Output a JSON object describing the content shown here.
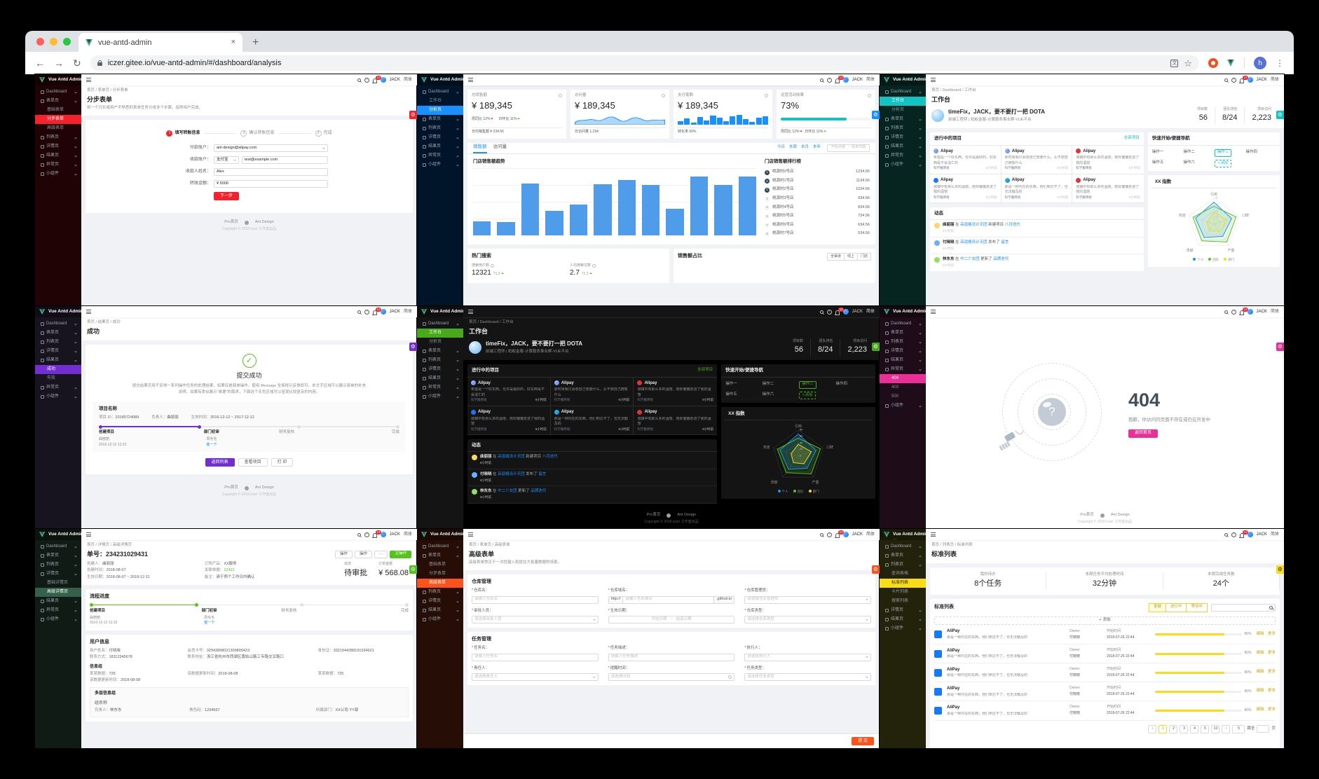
{
  "browser": {
    "tab_title": "vue-antd-admin",
    "close_tab": "×",
    "new_tab": "+",
    "url": "iczer.gitee.io/vue-antd-admin/#/dashboard/analysis",
    "avatar_letter": "h"
  },
  "glyphs": {
    "back": "←",
    "forward": "→",
    "reload": "↻",
    "star": "☆",
    "overflow": "⋮",
    "gear": "⚙",
    "check": "✓",
    "question": "?",
    "translate": "文",
    "alipay": "支",
    "plus": "+"
  },
  "common": {
    "logo": "Vue Antd Admin",
    "user": "JACK",
    "badge": "12",
    "lang": "简体",
    "footer_home": "Pro首页",
    "footer_antd": "Ant Design",
    "copyright": "Copyright © 2018 iczer 工作室出品"
  },
  "menus": {
    "stepform": [
      {
        "t": "Dashboard",
        "cls": "r"
      },
      {
        "t": "表单页",
        "cls": "r"
      },
      {
        "t": "基础表单",
        "cls": "c"
      },
      {
        "t": "分步表单",
        "cls": "c sel"
      },
      {
        "t": "高级表单",
        "cls": "c"
      },
      {
        "t": "列表页",
        "cls": "r"
      },
      {
        "t": "详情页",
        "cls": "r"
      },
      {
        "t": "结果页",
        "cls": "r"
      },
      {
        "t": "异常页",
        "cls": "r"
      },
      {
        "t": "小组件",
        "cls": "r"
      }
    ],
    "analysis": [
      {
        "t": "Dashboard",
        "cls": "r"
      },
      {
        "t": "工作台",
        "cls": "c"
      },
      {
        "t": "分析页",
        "cls": "c sel"
      },
      {
        "t": "表单页",
        "cls": "r"
      },
      {
        "t": "列表页",
        "c ls": "r",
        "cls": "r"
      },
      {
        "t": "详情页",
        "cls": "r"
      },
      {
        "t": "结果页",
        "cls": "r"
      },
      {
        "t": "异常页",
        "cls": "r"
      },
      {
        "t": "小组件",
        "cls": "r"
      }
    ],
    "workplace": [
      {
        "t": "Dashboard",
        "cls": "r"
      },
      {
        "t": "工作台",
        "cls": "c sel"
      },
      {
        "t": "分析页",
        "cls": "c"
      },
      {
        "t": "表单页",
        "cls": "r"
      },
      {
        "t": "列表页",
        "cls": "r"
      },
      {
        "t": "详情页",
        "cls": "r"
      },
      {
        "t": "结果页",
        "cls": "r"
      },
      {
        "t": "异常页",
        "cls": "r"
      },
      {
        "t": "小组件",
        "cls": "r"
      }
    ],
    "success": [
      {
        "t": "Dashboard",
        "cls": "r"
      },
      {
        "t": "表单页",
        "cls": "r"
      },
      {
        "t": "列表页",
        "cls": "r"
      },
      {
        "t": "详情页",
        "cls": "r"
      },
      {
        "t": "结果页",
        "cls": "r"
      },
      {
        "t": "成功",
        "cls": "c sel"
      },
      {
        "t": "失败",
        "cls": "c"
      },
      {
        "t": "异常页",
        "cls": "r"
      },
      {
        "t": "小组件",
        "cls": "r"
      }
    ],
    "notfound": [
      {
        "t": "Dashboard",
        "cls": "r"
      },
      {
        "t": "表单页",
        "cls": "r"
      },
      {
        "t": "列表页",
        "cls": "r"
      },
      {
        "t": "详情页",
        "cls": "r"
      },
      {
        "t": "结果页",
        "cls": "r"
      },
      {
        "t": "异常页",
        "cls": "r"
      },
      {
        "t": "404",
        "cls": "c sel"
      },
      {
        "t": "403",
        "cls": "c"
      },
      {
        "t": "500",
        "cls": "c"
      },
      {
        "t": "小组件",
        "cls": "r"
      }
    ],
    "detail": [
      {
        "t": "Dashboard",
        "cls": "r"
      },
      {
        "t": "表单页",
        "cls": "r"
      },
      {
        "t": "列表页",
        "cls": "r"
      },
      {
        "t": "详情页",
        "cls": "r"
      },
      {
        "t": "基础详情页",
        "cls": "c"
      },
      {
        "t": "高级详情页",
        "cls": "c sel"
      },
      {
        "t": "结果页",
        "cls": "r"
      },
      {
        "t": "异常页",
        "cls": "r"
      },
      {
        "t": "小组件",
        "cls": "r"
      }
    ],
    "advform": [
      {
        "t": "Dashboard",
        "cls": "r"
      },
      {
        "t": "表单页",
        "cls": "r"
      },
      {
        "t": "基础表单",
        "cls": "c"
      },
      {
        "t": "分步表单",
        "cls": "c"
      },
      {
        "t": "高级表单",
        "cls": "c sel"
      },
      {
        "t": "列表页",
        "cls": "r"
      },
      {
        "t": "详情页",
        "cls": "r"
      },
      {
        "t": "结果页",
        "cls": "r"
      },
      {
        "t": "小组件",
        "cls": "r"
      }
    ],
    "stdlist": [
      {
        "t": "Dashboard",
        "cls": "r"
      },
      {
        "t": "表单页",
        "cls": "r"
      },
      {
        "t": "列表页",
        "cls": "r"
      },
      {
        "t": "查询表格",
        "cls": "c"
      },
      {
        "t": "标准列表",
        "cls": "c sel"
      },
      {
        "t": "卡片列表",
        "cls": "c"
      },
      {
        "t": "搜索列表",
        "cls": "c"
      },
      {
        "t": "详情页",
        "cls": "r"
      },
      {
        "t": "结果页",
        "cls": "r"
      },
      {
        "t": "小组件",
        "cls": "r"
      }
    ]
  },
  "stepform": {
    "crumb": "首页 / 表单页 / 分步表单",
    "title": "分步表单",
    "desc": "将一个冗长或用户不熟悉的表单任务分成多个步骤，指导用户完成。",
    "steps": [
      {
        "n": "1",
        "t": "填写转账信息",
        "cls": "cur"
      },
      {
        "n": "2",
        "t": "确认转账信息",
        "cls": ""
      },
      {
        "n": "3",
        "t": "完成",
        "cls": ""
      }
    ],
    "f1_label": "付款账户：",
    "f1_value": "ant-design@alipay.com",
    "f2_label": "收款账户：",
    "f2_select": "支付宝",
    "f2_value": "test@example.com",
    "f3_label": "收款人姓名：",
    "f3_value": "Alex",
    "f4_label": "转账金额：",
    "f4_value": "¥ 5000",
    "next": "下一步"
  },
  "analysis": {
    "card1": {
      "label": "总销售额",
      "value": "¥ 189,345",
      "t1": "周同比 12%",
      "t2": "日环比 11%",
      "foot": "日均销售额 ¥ 234.56"
    },
    "card2": {
      "label": "访问量",
      "value": "¥ 189,345",
      "foot": "日访问量 1,234"
    },
    "card3": {
      "label": "支付笔数",
      "value": "¥ 189,345",
      "foot": "转化率 60%"
    },
    "card4": {
      "label": "运营活动效果",
      "value": "73%",
      "t1": "周同比 12%",
      "t2": "日环比 11%"
    },
    "tabs": [
      "销售额",
      "访问量"
    ],
    "ranges": [
      {
        "t": "今日"
      },
      {
        "t": "本周"
      },
      {
        "t": "本月"
      },
      {
        "t": "本年"
      }
    ],
    "date_start": "开始日期",
    "date_sep": "~",
    "date_end": "结束日期",
    "chart_title": "门店销售额趋势",
    "bars": [
      {
        "v": 21
      },
      {
        "v": 20
      },
      {
        "v": 77
      },
      {
        "v": 36
      },
      {
        "v": 46
      },
      {
        "v": 76
      },
      {
        "v": 82
      },
      {
        "v": 75
      },
      {
        "v": 40
      },
      {
        "v": 88
      },
      {
        "v": 75
      },
      {
        "v": 87
      }
    ],
    "minibars": [
      {
        "v": 5
      },
      {
        "v": 9
      },
      {
        "v": 3
      },
      {
        "v": 11
      },
      {
        "v": 6
      },
      {
        "v": 13
      },
      {
        "v": 10
      },
      {
        "v": 5
      },
      {
        "v": 12
      },
      {
        "v": 14
      },
      {
        "v": 8
      },
      {
        "v": 4
      },
      {
        "v": 10
      },
      {
        "v": 12
      }
    ],
    "progress_pct": 73,
    "rank_title": "门店销售额排行榜",
    "ranks": [
      {
        "r": "1",
        "n": "桃源村0号店",
        "v": "1234.56",
        "cls": "top"
      },
      {
        "r": "2",
        "n": "桃源村1号店",
        "v": "1134.56",
        "cls": "top"
      },
      {
        "r": "3",
        "n": "桃源村2号店",
        "v": "1034.56",
        "cls": "top"
      },
      {
        "r": "4",
        "n": "桃源村3号店",
        "v": "934.56",
        "cls": ""
      },
      {
        "r": "5",
        "n": "桃源村4号店",
        "v": "834.56",
        "cls": ""
      },
      {
        "r": "6",
        "n": "桃源村5号店",
        "v": "734.56",
        "cls": ""
      },
      {
        "r": "7",
        "n": "桃源村6号店",
        "v": "634.56",
        "cls": ""
      },
      {
        "r": "8",
        "n": "桃源村7号店",
        "v": "534.56",
        "cls": ""
      }
    ],
    "hot_title": "热门搜索",
    "hot1_label": "搜索用户数",
    "hot1_value": "12321",
    "hot1_trend": "71.2",
    "hot2_label": "人均搜索次数",
    "hot2_value": "2.7",
    "hot2_trend": "71.2",
    "share_title": "销售额占比",
    "share_tabs": [
      {
        "t": "全渠道"
      },
      {
        "t": "线上"
      },
      {
        "t": "门店"
      }
    ]
  },
  "workplace": {
    "crumb": "首页 / Dashboard / 工作台",
    "title": "工作台",
    "greeting": "timeFix，JACK，要不要打一把 DOTA",
    "sub": "前端工程师 | 蚂蚁金服-计算服务事业群-VUE平台",
    "stats": [
      {
        "label": "项目数",
        "value": "56"
      },
      {
        "label": "团队排名",
        "value": "8/24"
      },
      {
        "label": "项目访问",
        "value": "2,223"
      }
    ],
    "projects_title": "进行中的项目",
    "all_projects": "全部项目",
    "cards": [
      {
        "title": "Alipay",
        "desc": "希望是一个好东西，也许是最好的，好东西是不会消亡的",
        "group": "科学搬砖组",
        "time": "9小时前",
        "cls": "lg-antd"
      },
      {
        "title": "Alipay",
        "desc": "那时候我只会想自己想要什么，从不想自己拥有什么",
        "group": "科学搬砖组",
        "time": "9小时前",
        "cls": "lg-antd"
      },
      {
        "title": "Alipay",
        "desc": "城镇中有那么多的酒馆，她却偏偏走进了我的酒馆",
        "group": "科学搬砖组",
        "time": "9小时前",
        "cls": "lg-ng"
      },
      {
        "title": "Alipay",
        "desc": "城镇中有那么多的酒馆，她却偏偏走进了我的酒馆",
        "group": "科学搬砖组",
        "time": "9小时前",
        "cls": "lg-ali"
      },
      {
        "title": "Alipay",
        "desc": "那是一种内在的东西，他们到达不了，也无法触及的",
        "group": "科学搬砖组",
        "time": "9小时前",
        "cls": "lg-ali2"
      },
      {
        "title": "Alipay",
        "desc": "城镇中有那么多的酒馆，她却偏偏走进了我的酒馆",
        "group": "科学搬砖组",
        "time": "9小时前",
        "cls": "lg-ng"
      }
    ],
    "quick_title": "快速开始/便捷导航",
    "ops": [
      {
        "t": "操作一",
        "cls": ""
      },
      {
        "t": "操作二",
        "cls": ""
      },
      {
        "t": "操作三",
        "cls": "hot"
      },
      {
        "t": "操作四",
        "cls": ""
      },
      {
        "t": "操作五",
        "cls": ""
      },
      {
        "t": "操作六",
        "cls": ""
      }
    ],
    "add": "添加",
    "radar_title": "XX 指数",
    "radar_axes": [
      "引用",
      "口碑",
      "产量",
      "贡献",
      "热度"
    ],
    "radar_ticks": [
      "0",
      "20",
      "40",
      "60",
      "80"
    ],
    "legend": [
      {
        "t": "个人",
        "cls": "dot-blue"
      },
      {
        "t": "团队",
        "cls": "dot-green"
      },
      {
        "t": "部门",
        "cls": "dot-yellow"
      }
    ],
    "feed_title": "动态",
    "feed": [
      {
        "name": "曲丽丽",
        "pre": "在",
        "group": "高逼格设计天团",
        "mid": "新建项目",
        "target": "八月迭代",
        "time": "9小时前",
        "cls": "av-a"
      },
      {
        "name": "付晓晓",
        "pre": "在",
        "group": "高逼格设计天团",
        "mid": "发布了",
        "target": "留言",
        "time": "9小时前",
        "cls": "av-b"
      },
      {
        "name": "林东东",
        "pre": "在",
        "group": "中二少女团",
        "mid": "更新了",
        "target": "品牌迭代",
        "time": "9小时前",
        "cls": "av-c"
      }
    ]
  },
  "success": {
    "crumb": "首页 / 结果页 / 成功",
    "ptitle": "成功",
    "title": "提交成功",
    "desc": "提交结果页用于反馈一系列操作任务的处理结果，如果仅是简单操作，使用 Message 全局提示反馈即可。本文字区域可以展示简单的补充说明，如果有类似展示“单据”的需求，下面这个灰色区域可以呈现比较复杂的内容。",
    "box_title": "项目名称",
    "meta": [
      {
        "l": "项目 ID：",
        "v": "20180724089"
      },
      {
        "l": "负责人：",
        "v": "曲丽丽"
      },
      {
        "l": "生效时间：",
        "v": "2016-12-12 ~ 2017-12-12"
      }
    ],
    "steps": [
      {
        "t": "创建项目",
        "s1": "曲丽丽",
        "s2": "2016-12-12 12:32"
      },
      {
        "t": "部门初审",
        "s1": "周毛毛",
        "link": "催一下"
      },
      {
        "t": "财务复核"
      },
      {
        "t": "完成"
      }
    ],
    "btn1": "返回列表",
    "btn2": "查看项目",
    "btn3": "打 印"
  },
  "notfound": {
    "code": "404",
    "desc": "抱歉，你访问的页面不存在或仍在开发中",
    "btn": "返回首页"
  },
  "detail": {
    "crumb": "首页 / 详情页 / 高级详情页",
    "title": "单号：234231029431",
    "op1": "操作",
    "op2": "操作",
    "op3": "···",
    "op_main": "主操作",
    "info": [
      {
        "l": "创建人：",
        "v": "曲丽丽",
        "cls": ""
      },
      {
        "l": "订购产品：",
        "v": "XX服务",
        "cls": ""
      },
      {
        "l": "创建时间：",
        "v": "2018-08-07",
        "cls": ""
      },
      {
        "l": "关联单据：",
        "v": "12421",
        "cls": "link"
      },
      {
        "l": "生效日期：",
        "v": "2018-08-07 ~ 2018-12-11",
        "cls": ""
      },
      {
        "l": "备注：",
        "v": "请于两个工作日内确认",
        "cls": ""
      }
    ],
    "status_label": "状态",
    "status": "待审批",
    "amount_label": "订单金额",
    "amount": "¥ 568.08",
    "flow_title": "流程进度",
    "steps": [
      {
        "t": "创建项目",
        "s1": "曲丽丽",
        "s2": "2016-12-12 12:32"
      },
      {
        "t": "部门初审",
        "s1": "周毛毛",
        "link": "催一下"
      },
      {
        "t": "财务复核"
      },
      {
        "t": "完成"
      }
    ],
    "user_title": "用户信息",
    "user": [
      {
        "l": "用户姓名：",
        "v": "付晓晓"
      },
      {
        "l": "会员卡号：",
        "v": "32943898021309809423"
      },
      {
        "l": "身份证：",
        "v": "3321944288191034921"
      },
      {
        "l": "联系方式：",
        "v": "18112345678"
      },
      {
        "l": "联系地址：",
        "v": "浙江省杭州市西湖区黄姑山路工专路交叉路口"
      }
    ],
    "group_title": "信息组",
    "group": [
      {
        "l": "某某数据：",
        "v": "725"
      },
      {
        "l": "该数据更新时间：",
        "v": "2018-08-08"
      },
      {
        "l": "某某数据：",
        "v": "725"
      },
      {
        "l": "该数据更新时间：",
        "v": "2018-08-08"
      }
    ],
    "multi_title": "多层信息组",
    "multi_sub": "组名称",
    "multi": [
      {
        "l": "负责人：",
        "v": "林东东"
      },
      {
        "l": "角色码：",
        "v": "1234567"
      },
      {
        "l": "所属部门：",
        "v": "XX公司-YY部"
      }
    ]
  },
  "advform": {
    "crumb": "首页 / 表单页 / 高级表单",
    "title": "高级表单",
    "desc": "高级表单常见于一次性输入和提交大批量数据的场景。",
    "repo_title": "仓库管理",
    "repo": [
      {
        "label": "仓库名",
        "ph": "请输入仓库名",
        "cls": "f-input"
      },
      {
        "label": "仓库域名",
        "ph": "请输入仓库域名",
        "b": "http://",
        "a": ".github.io",
        "cls": "f-domain"
      },
      {
        "label": "仓库管理员",
        "ph": "请选择仓库管理员",
        "cls": "f-select"
      },
      {
        "label": "审批人员",
        "ph": "请选择审批人员",
        "cls": "f-select"
      },
      {
        "label": "生效日期",
        "ph": "开始日期",
        "mid": "~",
        "ph2": "结束日期",
        "cls": "f-date"
      },
      {
        "label": "仓库类型",
        "ph": "请选择仓库类型",
        "cls": "f-select"
      }
    ],
    "task_title": "任务管理",
    "task": [
      {
        "label": "任务名",
        "ph": "请输入任务名",
        "cls": "f-input"
      },
      {
        "label": "任务描述",
        "ph": "请输入任务描述",
        "cls": "f-input"
      },
      {
        "label": "执行人",
        "ph": "请选择执行人",
        "cls": "f-select"
      },
      {
        "label": "责任人",
        "ph": "请选择责任人",
        "cls": "f-select"
      },
      {
        "label": "提醒时间",
        "ph": "请选择时间",
        "cls": "f-time"
      },
      {
        "label": "任务类型",
        "ph": "请选择任务类型",
        "cls": "f-select"
      }
    ],
    "submit": "提 交"
  },
  "stdlist": {
    "crumb": "首页 / 列表页 / 标准列表",
    "title": "标准列表",
    "stats": [
      {
        "label": "我的待办",
        "value": "8个任务"
      },
      {
        "label": "本周任务平均处理时间",
        "value": "32分钟"
      },
      {
        "label": "本周完成任务数",
        "value": "24个"
      }
    ],
    "card_title": "标准列表",
    "filters": [
      {
        "t": "全部",
        "cls": "cur"
      },
      {
        "t": "进行中",
        "cls": ""
      },
      {
        "t": "等待中",
        "cls": ""
      }
    ],
    "add": "添加",
    "rows": [
      {
        "title": "AliPay",
        "desc": "那是一种内在的东西，他们到达不了，也无法触及的",
        "owner_label": "Owner",
        "owner": "付晓晓",
        "time_label": "开始时间",
        "time": "2018-07-26 22:44",
        "pct": 80,
        "pct_text": "80%",
        "edit": "编辑",
        "more": "更多"
      },
      {
        "title": "AliPay",
        "desc": "那是一种内在的东西，他们到达不了，也无法触及的",
        "owner_label": "Owner",
        "owner": "付晓晓",
        "time_label": "开始时间",
        "time": "2018-07-26 22:44",
        "pct": 80,
        "pct_text": "80%",
        "edit": "编辑",
        "more": "更多"
      },
      {
        "title": "AliPay",
        "desc": "那是一种内在的东西，他们到达不了，也无法触及的",
        "owner_label": "Owner",
        "owner": "付晓晓",
        "time_label": "开始时间",
        "time": "2018-07-26 22:44",
        "pct": 80,
        "pct_text": "80%",
        "edit": "编辑",
        "more": "更多"
      },
      {
        "title": "AliPay",
        "desc": "那是一种内在的东西，他们到达不了，也无法触及的",
        "owner_label": "Owner",
        "owner": "付晓晓",
        "time_label": "开始时间",
        "time": "2018-07-26 22:44",
        "pct": 80,
        "pct_text": "80%",
        "edit": "编辑",
        "more": "更多"
      },
      {
        "title": "AliPay",
        "desc": "那是一种内在的东西，他们到达不了，也无法触及的",
        "owner_label": "Owner",
        "owner": "付晓晓",
        "time_label": "开始时间",
        "time": "2018-07-26 22:44",
        "pct": 80,
        "pct_text": "80%",
        "edit": "编辑",
        "more": "更多"
      }
    ],
    "pager": [
      {
        "t": "‹",
        "cls": ""
      },
      {
        "t": "1",
        "cls": "cur"
      },
      {
        "t": "2",
        "cls": ""
      },
      {
        "t": "3",
        "cls": ""
      },
      {
        "t": "4",
        "cls": ""
      },
      {
        "t": "5",
        "cls": ""
      },
      {
        "t": "···",
        "cls": "dots"
      },
      {
        "t": "10",
        "cls": ""
      },
      {
        "t": "›",
        "cls": ""
      }
    ],
    "size": "5",
    "jump_pre": "跳至",
    "jump_post": "页"
  }
}
